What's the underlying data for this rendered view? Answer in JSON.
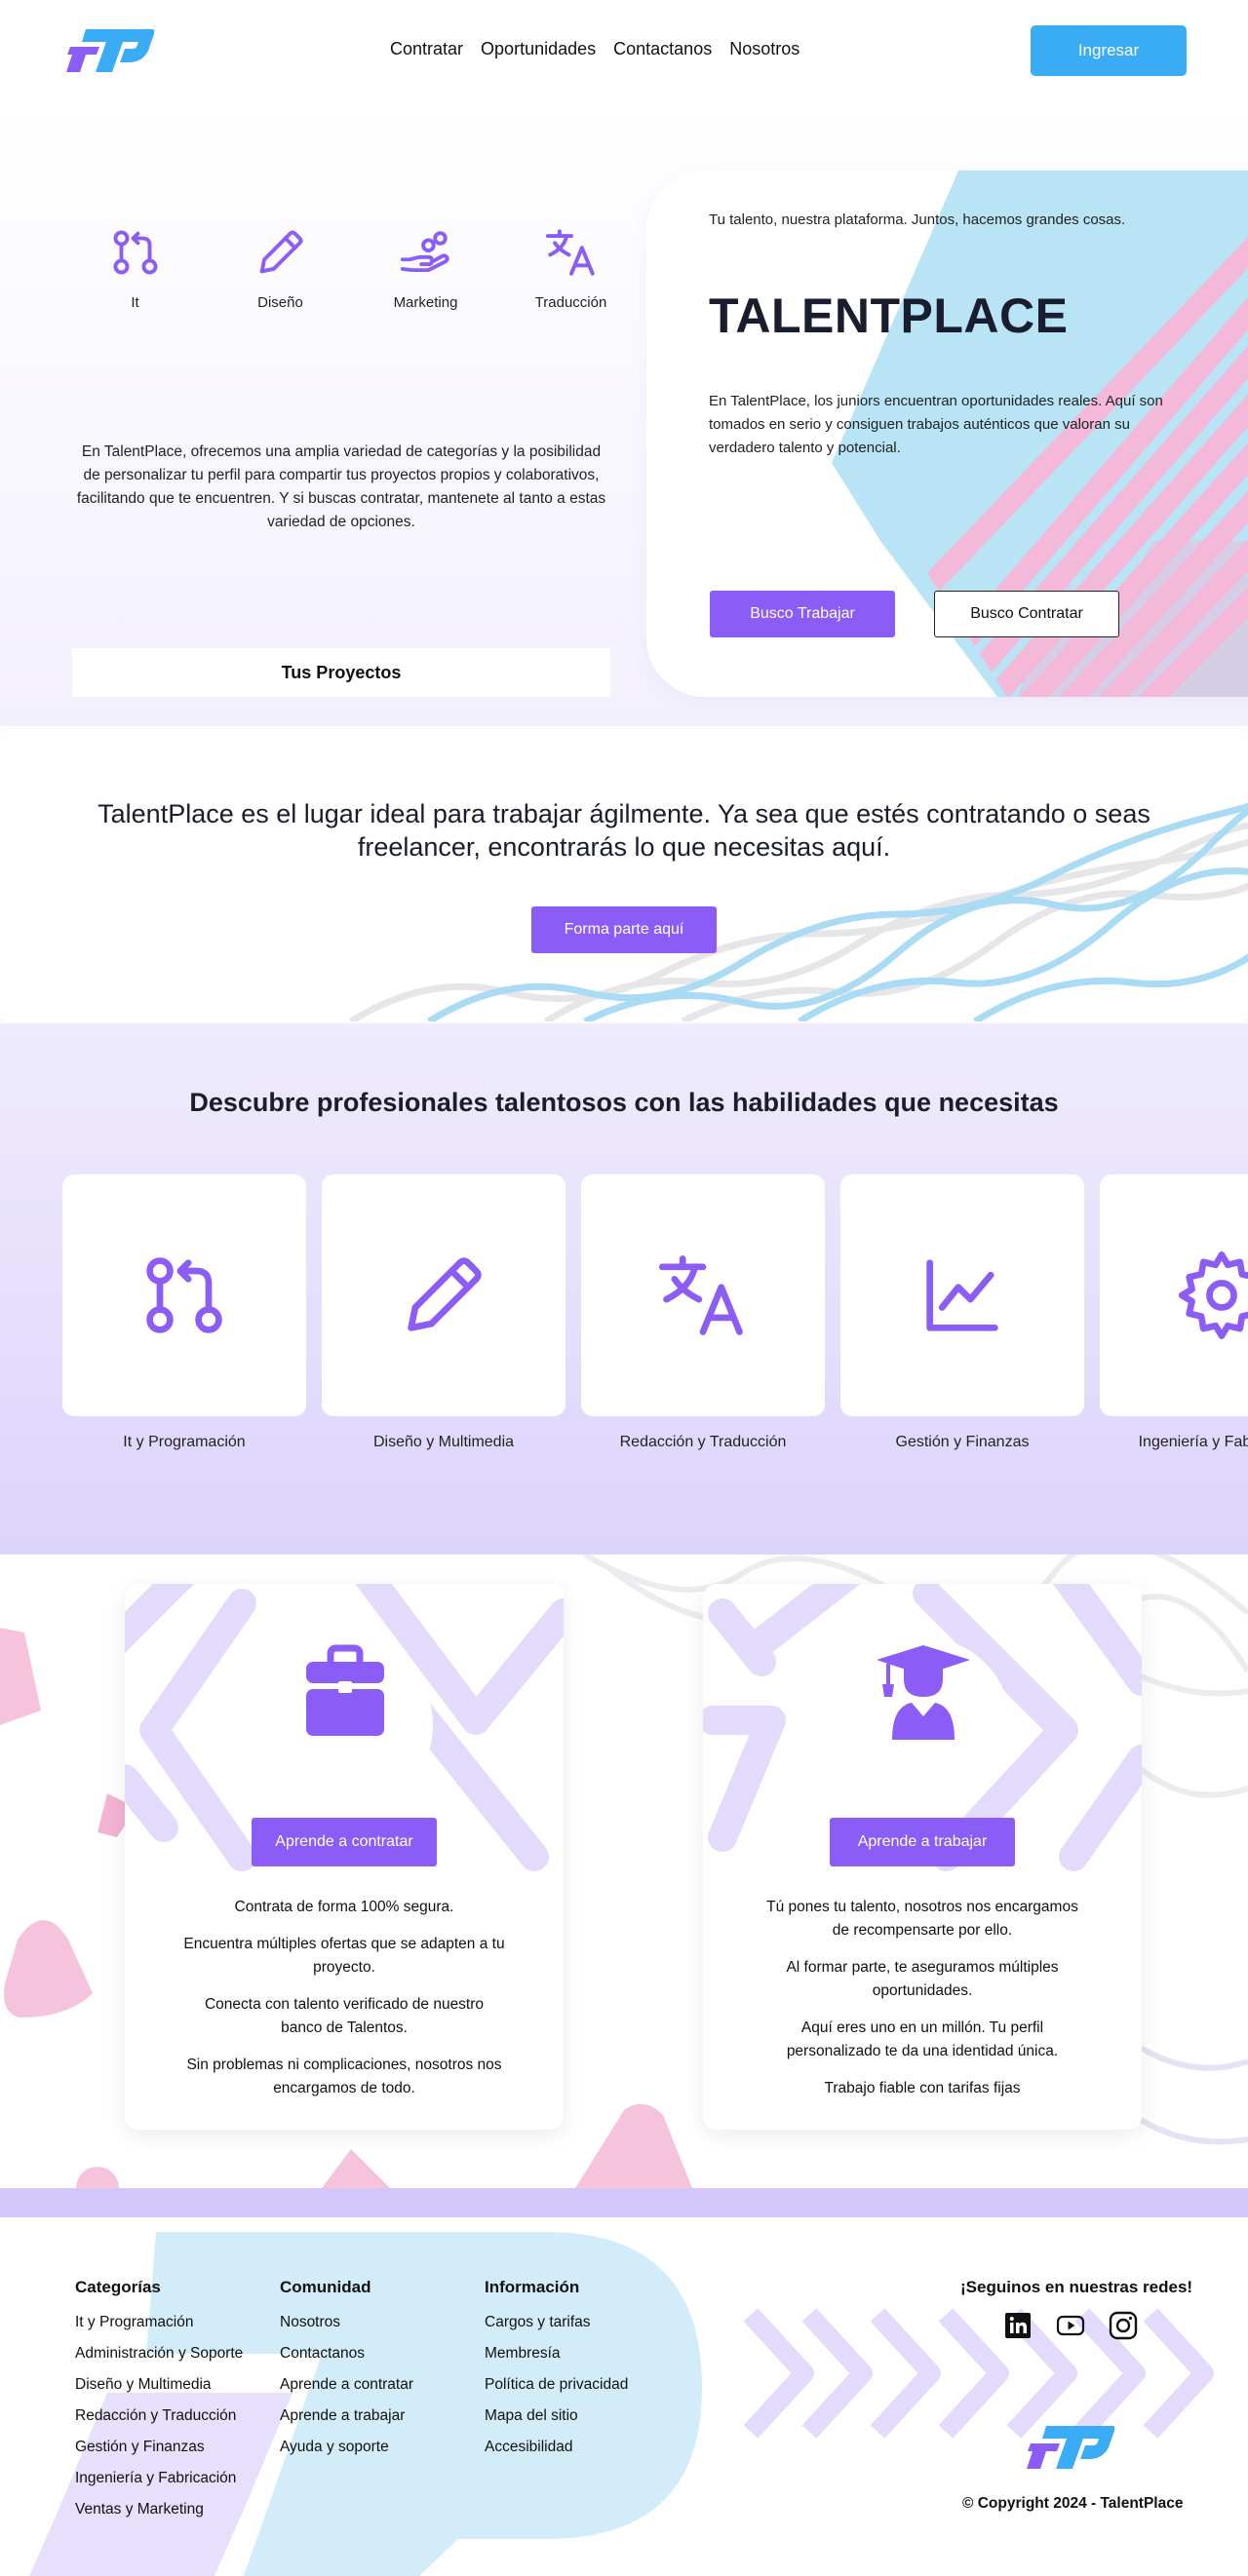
{
  "header": {
    "nav": [
      "Contratar",
      "Oportunidades",
      "Contactanos",
      "Nosotros"
    ],
    "login_label": "Ingresar"
  },
  "hero": {
    "categories": [
      {
        "label": "It",
        "icon": "git-pull-request-icon"
      },
      {
        "label": "Diseño",
        "icon": "pencil-icon"
      },
      {
        "label": "Marketing",
        "icon": "hand-coins-icon"
      },
      {
        "label": "Traducción",
        "icon": "translate-icon"
      }
    ],
    "description": "En TalentPlace, ofrecemos una amplia variedad de categorías y la posibilidad de personalizar tu perfil para compartir tus proyectos propios y colaborativos, facilitando que te encuentren. Y si buscas contratar, mantenete al tanto a estas  variedad de opciones.",
    "projects_label": "Tus Proyectos",
    "card": {
      "tagline": "Tu talento, nuestra plataforma. Juntos, hacemos grandes cosas.",
      "title": "TALENTPLACE",
      "description": "En TalentPlace, los juniors encuentran oportunidades reales. Aquí son tomados en serio y consiguen trabajos auténticos que valoran su verdadero talento y potencial.",
      "work_label": "Busco Trabajar",
      "hire_label": "Busco Contratar"
    }
  },
  "ideal": {
    "text": "TalentPlace es el lugar ideal para trabajar ágilmente. Ya sea que estés contratando o seas freelancer, encontrarás lo que necesitas aquí.",
    "join_label": "Forma parte aquí"
  },
  "skills": {
    "title": "Descubre profesionales talentosos con las habilidades que necesitas",
    "items": [
      {
        "label": "It y Programación",
        "icon": "git-pull-request-icon"
      },
      {
        "label": "Diseño y Multimedia",
        "icon": "pencil-icon"
      },
      {
        "label": "Redacción y Traducción",
        "icon": "translate-icon"
      },
      {
        "label": "Gestión y Finanzas",
        "icon": "chart-line-icon"
      },
      {
        "label": "Ingeniería y Fabricación",
        "icon": "gear-icon"
      }
    ]
  },
  "learn": {
    "hire": {
      "icon": "briefcase-icon",
      "button": "Aprende a contratar",
      "lines": [
        "Contrata de forma 100% segura.",
        "Encuentra múltiples ofertas que se adapten a tu proyecto.",
        "Conecta con talento verificado de nuestro banco de Talentos.",
        "Sin problemas ni complicaciones, nosotros nos encargamos de todo."
      ]
    },
    "work": {
      "icon": "graduate-icon",
      "button": "Aprende a trabajar",
      "lines": [
        "Tú pones tu talento, nosotros nos encargamos de recompensarte por ello.",
        "Al formar parte, te aseguramos múltiples oportunidades.",
        "Aquí eres uno en un millón. Tu perfil personalizado te da una identidad única.",
        "Trabajo fiable con tarifas fijas"
      ]
    }
  },
  "footer": {
    "categories": {
      "title": "Categorías",
      "items": [
        "It y Programación",
        "Administración y Soporte",
        "Diseño y Multimedia",
        "Redacción y Traducción",
        "Gestión y Finanzas",
        "Ingeniería y Fabricación",
        "Ventas y Marketing"
      ]
    },
    "community": {
      "title": "Comunidad",
      "items": [
        "Nosotros",
        "Contactanos",
        "Aprende a contratar",
        "Aprende a trabajar",
        "Ayuda y soporte"
      ]
    },
    "info": {
      "title": "Información",
      "items": [
        "Cargos y tarifas",
        "Membresía",
        "Política de privacidad",
        "Mapa del sitio",
        "Accesibilidad"
      ]
    },
    "social_title": "¡Seguinos en nuestras redes!",
    "social_icons": [
      "linkedin-icon",
      "youtube-icon",
      "instagram-icon"
    ],
    "copyright": "© Copyright 2024 - TalentPlace"
  },
  "colors": {
    "primary": "#8b5cf6",
    "accent_blue": "#3aacf5",
    "pink": "#f4b8d8",
    "light_blue": "#b8e4f5",
    "lavender": "#ddd4fb"
  }
}
